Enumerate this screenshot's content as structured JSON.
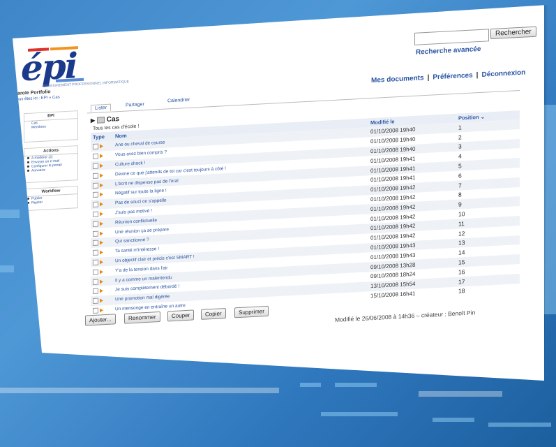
{
  "search": {
    "button_label": "Rechercher",
    "advanced_label": "Recherche avancée"
  },
  "userlinks": {
    "my_docs": "Mes documents",
    "prefs": "Préférences",
    "logout": "Déconnexion",
    "separator": "|"
  },
  "logo": {
    "text": "épi",
    "subtitle": "ENSEIGNEMENT PROFESSIONNEL INFORMATIQUE"
  },
  "portfolio": {
    "title": "Carole Portfolio",
    "breadcrumb": "Vous êtes ici : EPI » Cas"
  },
  "sidebar": {
    "tree_title": "EPI",
    "tree_items": [
      "Cas",
      "Membres"
    ],
    "actions_title": "Actions",
    "actions_items": [
      "A modérer (2)",
      "Envoyer un e-mail",
      "Configurer le portail",
      "Annuaire"
    ],
    "workflow_title": "Workflow",
    "workflow_items": [
      "Publier",
      "Rejeter"
    ]
  },
  "tabs": {
    "list": "Lister",
    "share": "Partager",
    "calendar": "Calendrier"
  },
  "folder": {
    "name": "Cas",
    "description": "Tous les cas d'école !"
  },
  "table": {
    "col_type": "Type",
    "col_name": "Nom",
    "col_modified": "Modifié le",
    "col_position": "Position",
    "rows": [
      {
        "name": "Ane ou cheval de course",
        "date": "01/10/2008 19h40",
        "pos": "1"
      },
      {
        "name": "Vous avez bien compris ?",
        "date": "01/10/2008 19h40",
        "pos": "2"
      },
      {
        "name": "Culture shock !",
        "date": "01/10/2008 19h40",
        "pos": "3"
      },
      {
        "name": "Devine ce que j'attends de toi car c'est toujours à côté !",
        "date": "01/10/2008 19h41",
        "pos": "4"
      },
      {
        "name": "L'écrit ne dispense pas de l'oral",
        "date": "01/10/2008 19h41",
        "pos": "5"
      },
      {
        "name": "Négatif sur toute la ligne !",
        "date": "01/10/2008 19h41",
        "pos": "6"
      },
      {
        "name": "Pas de souci on s'appelle",
        "date": "01/10/2008 19h42",
        "pos": "7"
      },
      {
        "name": "J'suis pas motivé !",
        "date": "01/10/2008 19h42",
        "pos": "8"
      },
      {
        "name": "Réunion conflictuelle",
        "date": "01/10/2008 19h42",
        "pos": "9"
      },
      {
        "name": "Une réunion ça se prépare",
        "date": "01/10/2008 19h42",
        "pos": "10"
      },
      {
        "name": "Qui sanctionne ?",
        "date": "01/10/2008 19h42",
        "pos": "11"
      },
      {
        "name": "Ta santé m'intéresse !",
        "date": "01/10/2008 19h42",
        "pos": "12"
      },
      {
        "name": "Un objectif clair et précis c'est SMART !",
        "date": "01/10/2008 19h43",
        "pos": "13"
      },
      {
        "name": "Y'a de la tension dans l'air",
        "date": "01/10/2008 19h43",
        "pos": "14"
      },
      {
        "name": "Il y a comme un malentendu",
        "date": "09/10/2008 13h28",
        "pos": "15"
      },
      {
        "name": "Je suis complètement débordé !",
        "date": "09/10/2008 18h24",
        "pos": "16"
      },
      {
        "name": "Une promotion mal digérée",
        "date": "13/10/2008 15h54",
        "pos": "17"
      },
      {
        "name": "Un mensonge en entraîne un autre",
        "date": "15/10/2008 16h41",
        "pos": "18"
      }
    ]
  },
  "actions": {
    "add": "Ajouter...",
    "rename": "Renommer",
    "cut": "Couper",
    "copy": "Copier",
    "delete": "Supprimer"
  },
  "footer": "Modifié le 26/06/2008 à 14h36 – créateur : Benoît Pin",
  "colors": {
    "link": "#2a55a2",
    "accent_orange": "#e88a17",
    "background_blue": "#3f86c8"
  }
}
